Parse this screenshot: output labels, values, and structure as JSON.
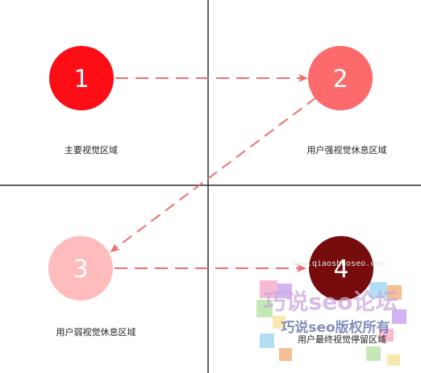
{
  "colors": {
    "background": "#ffffff",
    "axis": "#2b2b2b",
    "arrow": "#ee6f6f",
    "zone1": "#fd0d16",
    "zone2": "#fd6a6c",
    "zone3": "#ffbcbc",
    "zone4": "#760c0c",
    "label_text": "#222222"
  },
  "zones": [
    {
      "number": "1",
      "label": "主要视觉区域"
    },
    {
      "number": "2",
      "label": "用户强视觉休息区域"
    },
    {
      "number": "3",
      "label": "用户弱视觉休息区域"
    },
    {
      "number": "4",
      "label": "用户最终视觉停留区域"
    }
  ],
  "arrows": [
    {
      "from": "1",
      "to": "2"
    },
    {
      "from": "2",
      "to": "3"
    },
    {
      "from": "3",
      "to": "4"
    }
  ],
  "watermark": {
    "title": "巧说seo论坛",
    "subtitle": "巧说seo版权所有",
    "url": "www.qiaoshuoseo.com",
    "mosaic_colors": [
      "#f7a8c9",
      "#c8a2f0",
      "#9fd6f2",
      "#b6e3a4",
      "#f6e39a",
      "#f4b07c"
    ]
  }
}
